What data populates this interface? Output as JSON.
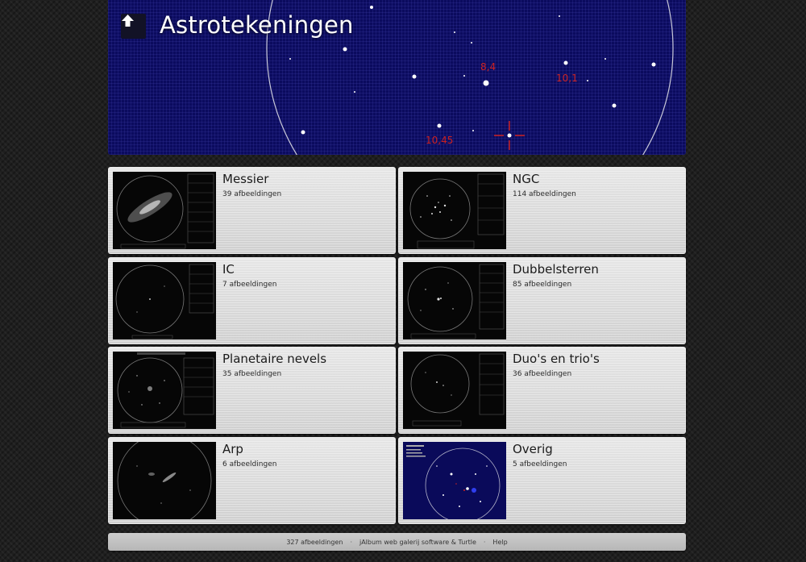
{
  "header": {
    "title": "Astrotekeningen",
    "up_icon": "arrow-up-icon",
    "chart_labels": [
      "8,4",
      "10,1",
      "10,45"
    ],
    "accent_color": "#0b0b5e",
    "label_color": "#cc2222"
  },
  "albums": [
    {
      "title": "Messier",
      "count": "39 afbeeldingen",
      "thumb": "galaxy-drawing"
    },
    {
      "title": "NGC",
      "count": "114 afbeeldingen",
      "thumb": "star-field-drawing"
    },
    {
      "title": "IC",
      "count": "7 afbeeldingen",
      "thumb": "sparse-field-drawing"
    },
    {
      "title": "Dubbelsterren",
      "count": "85 afbeeldingen",
      "thumb": "double-star-drawing"
    },
    {
      "title": "Planetaire nevels",
      "count": "35 afbeeldingen",
      "thumb": "nebula-drawing"
    },
    {
      "title": "Duo's en trio's",
      "count": "36 afbeeldingen",
      "thumb": "duo-drawing"
    },
    {
      "title": "Arp",
      "count": "6 afbeeldingen",
      "thumb": "arp-drawing"
    },
    {
      "title": "Overig",
      "count": "5 afbeeldingen",
      "thumb": "star-chart-drawing"
    }
  ],
  "footer": {
    "total": "327 afbeeldingen",
    "credit": "jAlbum web galerij software & Turtle",
    "help": "Help"
  }
}
